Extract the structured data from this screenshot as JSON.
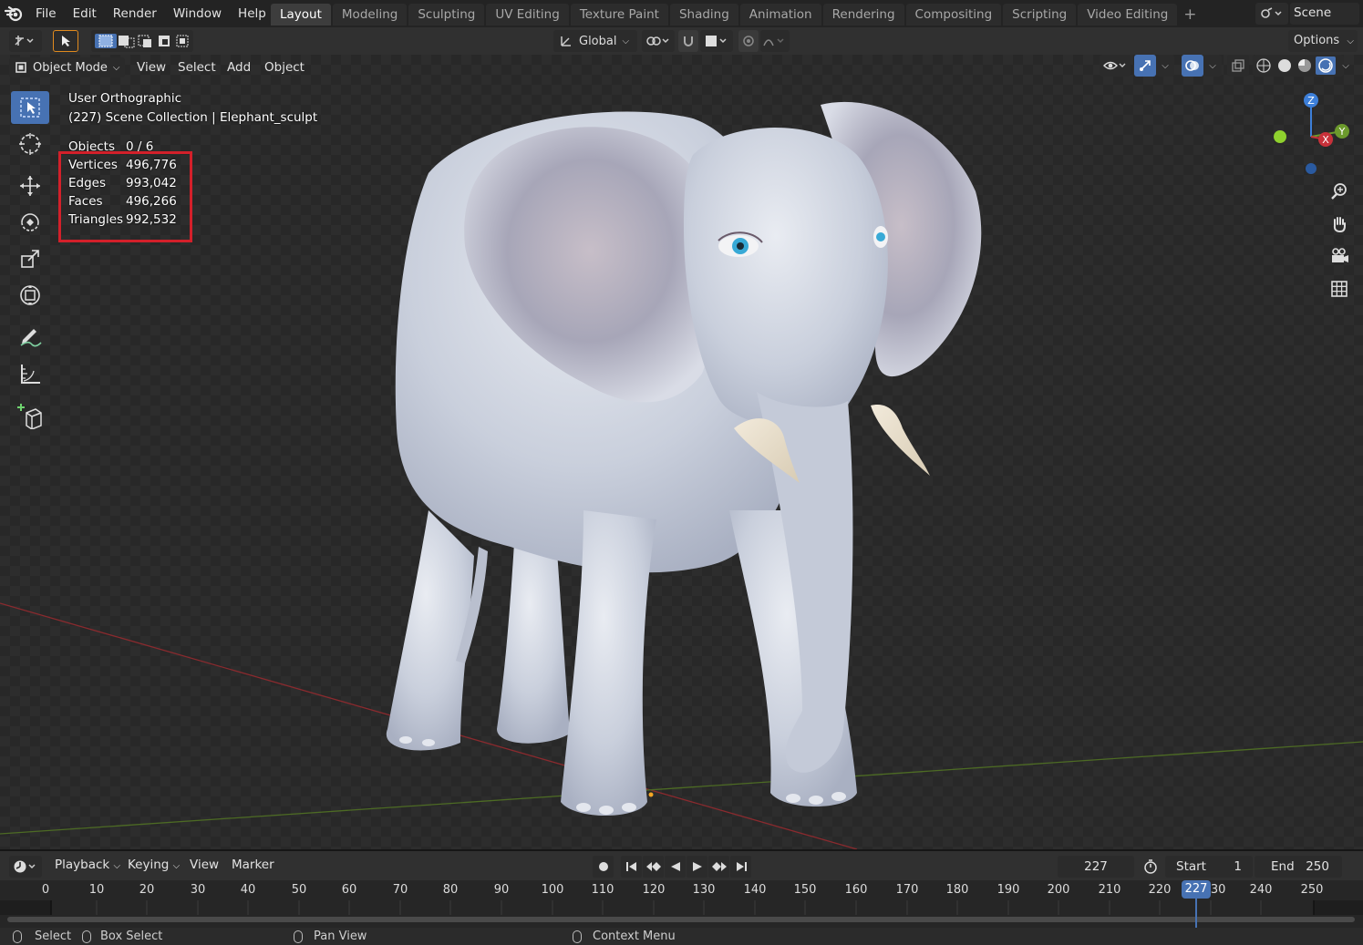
{
  "topbar": {
    "menus": [
      "File",
      "Edit",
      "Render",
      "Window",
      "Help"
    ],
    "workspaces": [
      "Layout",
      "Modeling",
      "Sculpting",
      "UV Editing",
      "Texture Paint",
      "Shading",
      "Animation",
      "Rendering",
      "Compositing",
      "Scripting",
      "Video Editing"
    ],
    "active_workspace": "Layout",
    "add_workspace": "+",
    "scene_name": "Scene"
  },
  "toolheader": {
    "orientation": "Global",
    "options": "Options"
  },
  "viewport": {
    "mode": "Object Mode",
    "menus": [
      "View",
      "Select",
      "Add",
      "Object"
    ],
    "view_name": "User Orthographic",
    "collection_info": "(227) Scene Collection | Elephant_sculpt",
    "stats": [
      {
        "label": "Objects",
        "value": "0 / 6"
      },
      {
        "label": "Vertices",
        "value": "496,776"
      },
      {
        "label": "Edges",
        "value": "993,042"
      },
      {
        "label": "Faces",
        "value": "496,266"
      },
      {
        "label": "Triangles",
        "value": "992,532"
      }
    ],
    "gizmo_axes": {
      "z": "Z",
      "y": "Y",
      "x": "X"
    },
    "colors": {
      "x_axis": "#c8313a",
      "y_axis": "#6c9a2c",
      "z_axis": "#3d7fd9",
      "active": "#4772b3"
    }
  },
  "timeline": {
    "menus": [
      "Playback",
      "Keying",
      "View",
      "Marker"
    ],
    "current_frame": "227",
    "start_label": "Start",
    "start": "1",
    "end_label": "End",
    "end": "250",
    "ruler": [
      "0",
      "10",
      "20",
      "30",
      "40",
      "50",
      "60",
      "70",
      "80",
      "90",
      "100",
      "110",
      "120",
      "130",
      "140",
      "150",
      "160",
      "170",
      "180",
      "190",
      "200",
      "210",
      "220",
      "227",
      "230",
      "240",
      "250"
    ],
    "playhead": "227"
  },
  "statusbar": {
    "select": "Select",
    "box_select": "Box Select",
    "pan_view": "Pan View",
    "context_menu": "Context Menu"
  }
}
